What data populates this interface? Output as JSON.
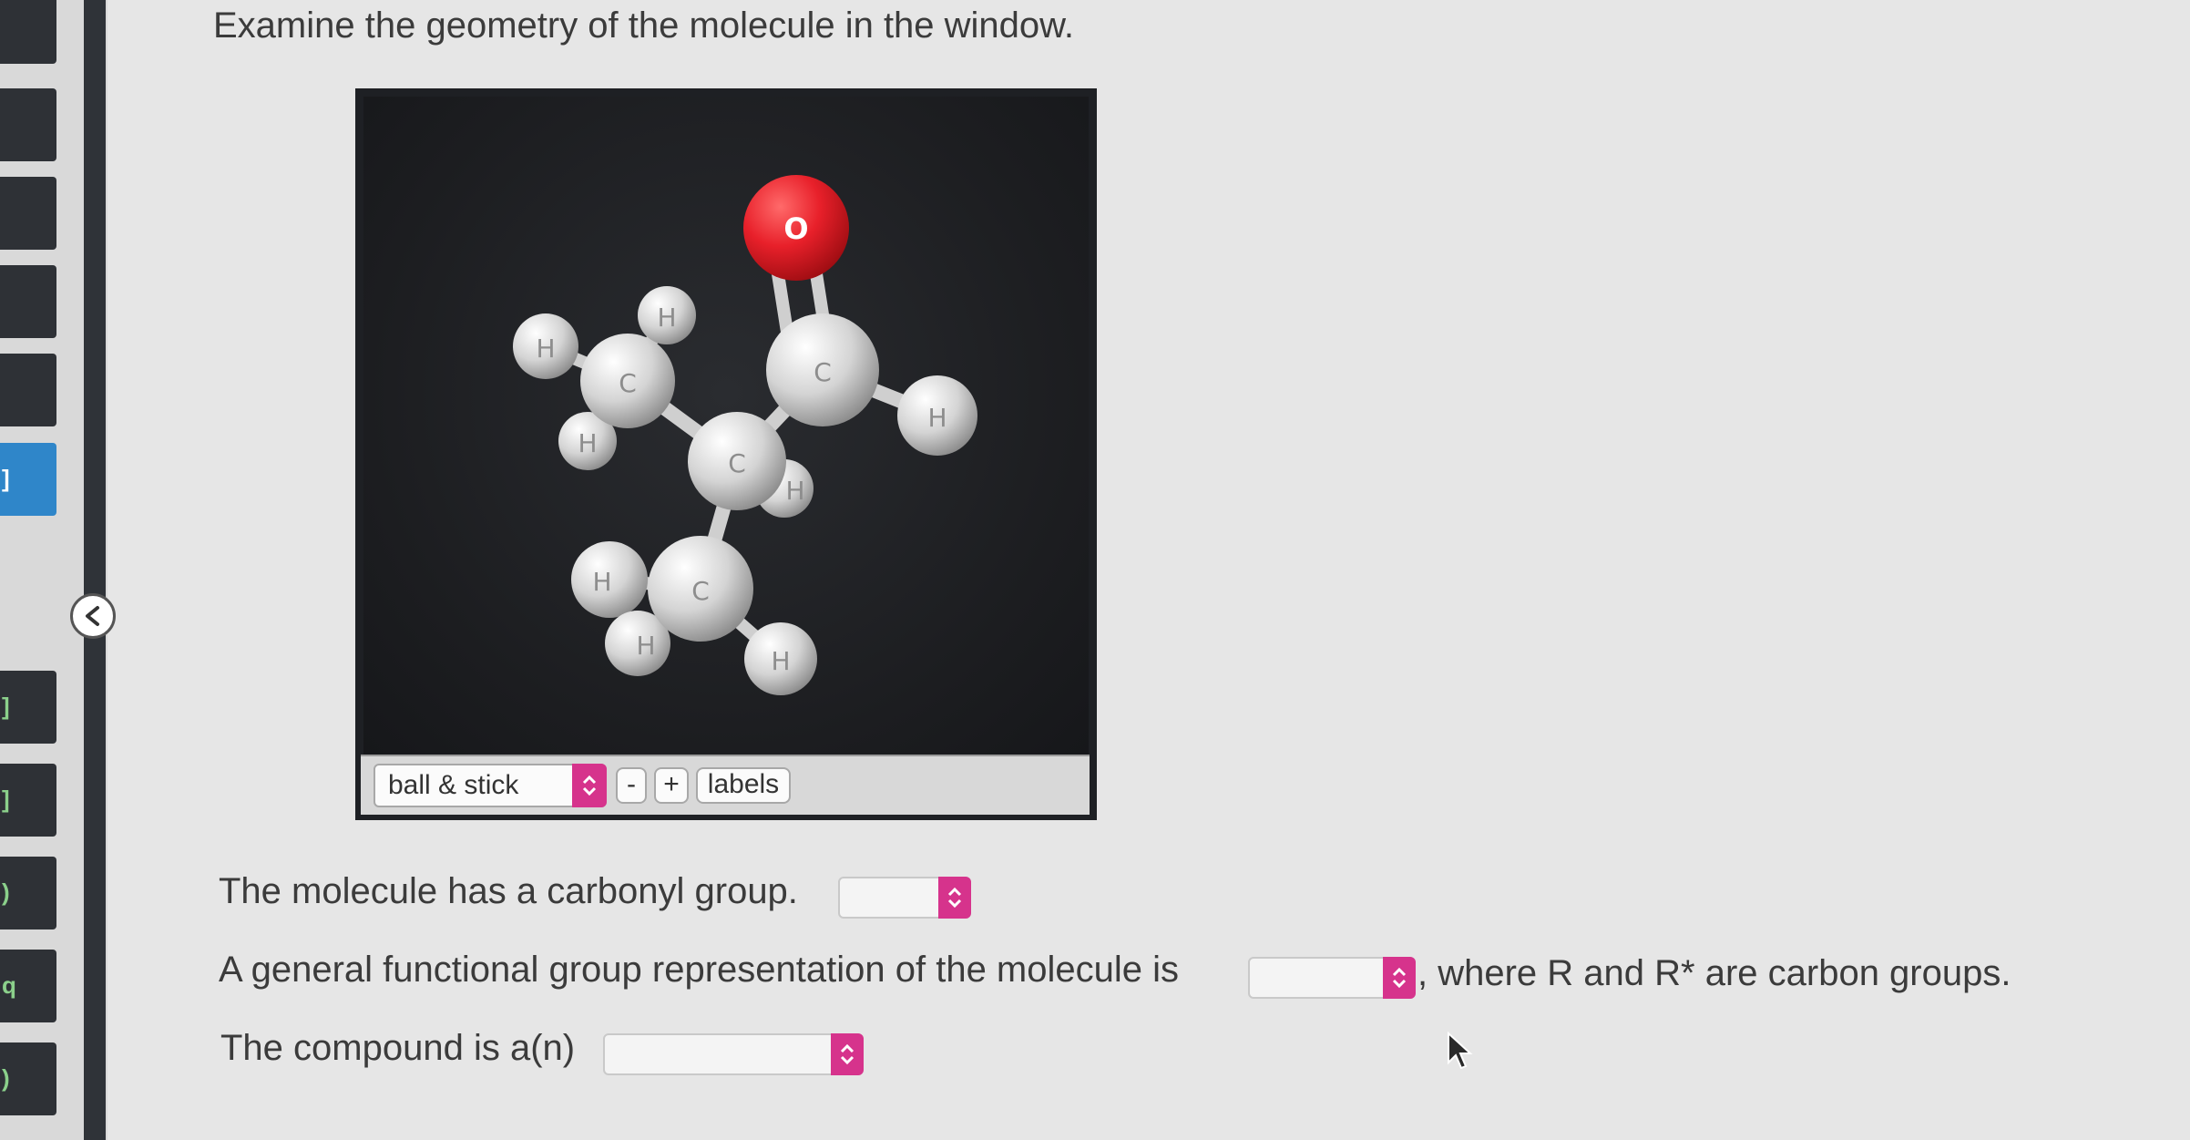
{
  "prompt": "Examine the geometry of the molecule in the window.",
  "viewer": {
    "style_select": {
      "selected": "ball & stick"
    },
    "zoom_out_label": "-",
    "zoom_in_label": "+",
    "labels_button": "labels",
    "atom_labels": {
      "oxygen": "O",
      "carbon": "C",
      "hydrogen": "H"
    },
    "colors": {
      "oxygen": "#e8202a",
      "carbon": "#d9d9d9",
      "background": "#1c1d20"
    }
  },
  "questions": {
    "q1": "The molecule has a carbonyl group.",
    "q2_before": "A general functional group representation of the molecule is",
    "q2_after": ", where R and R* are carbon groups.",
    "q3": "The compound is a(n)"
  },
  "sidebar": {
    "tab_marks": [
      "",
      "",
      "",
      "",
      "",
      "]",
      "",
      "",
      "]",
      "]",
      ")",
      "q",
      ")"
    ]
  },
  "accent_color": "#d6338c"
}
